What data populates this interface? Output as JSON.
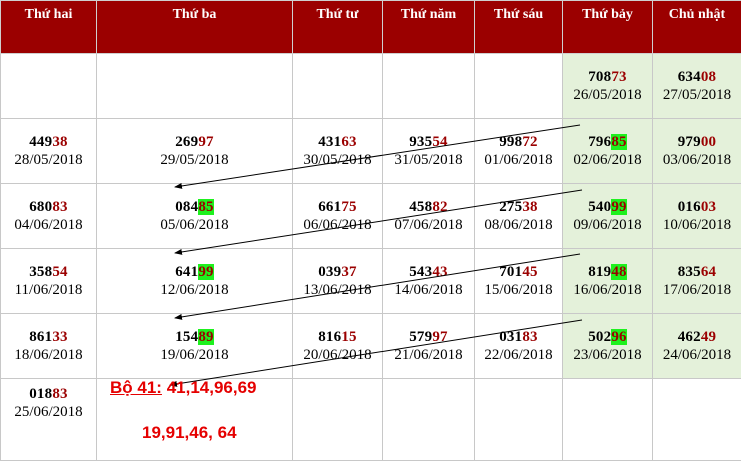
{
  "header": [
    "Thứ hai",
    "Thứ ba",
    "Thứ tư",
    "Thứ năm",
    "Thứ sáu",
    "Thứ bảy",
    "Chủ nhật"
  ],
  "rows": [
    [
      null,
      null,
      null,
      null,
      null,
      {
        "a": "708",
        "b": "73",
        "date": "26/05/2018"
      },
      {
        "a": "634",
        "b": "08",
        "date": "27/05/2018"
      }
    ],
    [
      {
        "a": "449",
        "b": "38",
        "date": "28/05/2018"
      },
      {
        "a": "269",
        "b": "97",
        "date": "29/05/2018"
      },
      {
        "a": "431",
        "b": "63",
        "date": "30/05/2018"
      },
      {
        "a": "935",
        "b": "54",
        "date": "31/05/2018"
      },
      {
        "a": "998",
        "b": "72",
        "date": "01/06/2018"
      },
      {
        "a": "796",
        "b": "85",
        "date": "02/06/2018",
        "hl": true
      },
      {
        "a": "979",
        "b": "00",
        "date": "03/06/2018"
      }
    ],
    [
      {
        "a": "680",
        "b": "83",
        "date": "04/06/2018"
      },
      {
        "a": "084",
        "b": "85",
        "date": "05/06/2018",
        "hl": true
      },
      {
        "a": "661",
        "b": "75",
        "date": "06/06/2018"
      },
      {
        "a": "458",
        "b": "82",
        "date": "07/06/2018"
      },
      {
        "a": "275",
        "b": "38",
        "date": "08/06/2018"
      },
      {
        "a": "540",
        "b": "99",
        "date": "09/06/2018",
        "hl": true
      },
      {
        "a": "016",
        "b": "03",
        "date": "10/06/2018"
      }
    ],
    [
      {
        "a": "358",
        "b": "54",
        "date": "11/06/2018"
      },
      {
        "a": "641",
        "b": "99",
        "date": "12/06/2018",
        "hl": true
      },
      {
        "a": "039",
        "b": "37",
        "date": "13/06/2018"
      },
      {
        "a": "543",
        "b": "43",
        "date": "14/06/2018"
      },
      {
        "a": "701",
        "b": "45",
        "date": "15/06/2018"
      },
      {
        "a": "819",
        "b": "48",
        "date": "16/06/2018",
        "hl": true
      },
      {
        "a": "835",
        "b": "64",
        "date": "17/06/2018"
      }
    ],
    [
      {
        "a": "861",
        "b": "33",
        "date": "18/06/2018"
      },
      {
        "a": "154",
        "b": "89",
        "date": "19/06/2018",
        "hl": true
      },
      {
        "a": "816",
        "b": "15",
        "date": "20/06/2018"
      },
      {
        "a": "579",
        "b": "97",
        "date": "21/06/2018"
      },
      {
        "a": "031",
        "b": "83",
        "date": "22/06/2018"
      },
      {
        "a": "502",
        "b": "96",
        "date": "23/06/2018",
        "hl": true
      },
      {
        "a": "462",
        "b": "49",
        "date": "24/06/2018"
      }
    ],
    [
      {
        "a": "018",
        "b": "83",
        "date": "25/06/2018"
      },
      null,
      null,
      null,
      null,
      null,
      null
    ]
  ],
  "bo": {
    "label": "Bộ 41:",
    "line1": " 41,14,96,69",
    "line2": "19,91,46, 64"
  },
  "colors": {
    "header_bg": "#9b0000",
    "weekend_bg": "#e4f1da",
    "highlight": "#1ef11e",
    "accent": "#e50000"
  }
}
